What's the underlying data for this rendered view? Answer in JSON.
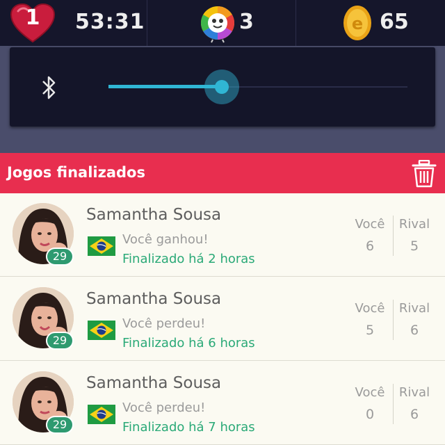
{
  "status_bar": {
    "lives": "1",
    "timer": "53:31",
    "spins": "3",
    "coins": "65",
    "icons": [
      "heart-icon",
      "trivia-wheel-icon",
      "coin-icon"
    ]
  },
  "volume_panel": {
    "icon": "bluetooth-icon",
    "level": 0.38,
    "accent": "#30b6d4"
  },
  "section": {
    "title": "Jogos finalizados",
    "icon": "trash-icon",
    "color": "#e82e4f"
  },
  "columns": {
    "you_label": "Você",
    "rival_label": "Rival"
  },
  "games": [
    {
      "name": "Samantha Sousa",
      "level": "29",
      "flag": "brazil-flag-icon",
      "result": "Você ganhou!",
      "finished": "Finalizado há 2 horas",
      "you_score": "6",
      "rival_score": "5"
    },
    {
      "name": "Samantha Sousa",
      "level": "29",
      "flag": "brazil-flag-icon",
      "result": "Você perdeu!",
      "finished": "Finalizado há 6 horas",
      "you_score": "5",
      "rival_score": "6"
    },
    {
      "name": "Samantha Sousa",
      "level": "29",
      "flag": "brazil-flag-icon",
      "result": "Você perdeu!",
      "finished": "Finalizado há 7 horas",
      "you_score": "0",
      "rival_score": "6"
    }
  ]
}
